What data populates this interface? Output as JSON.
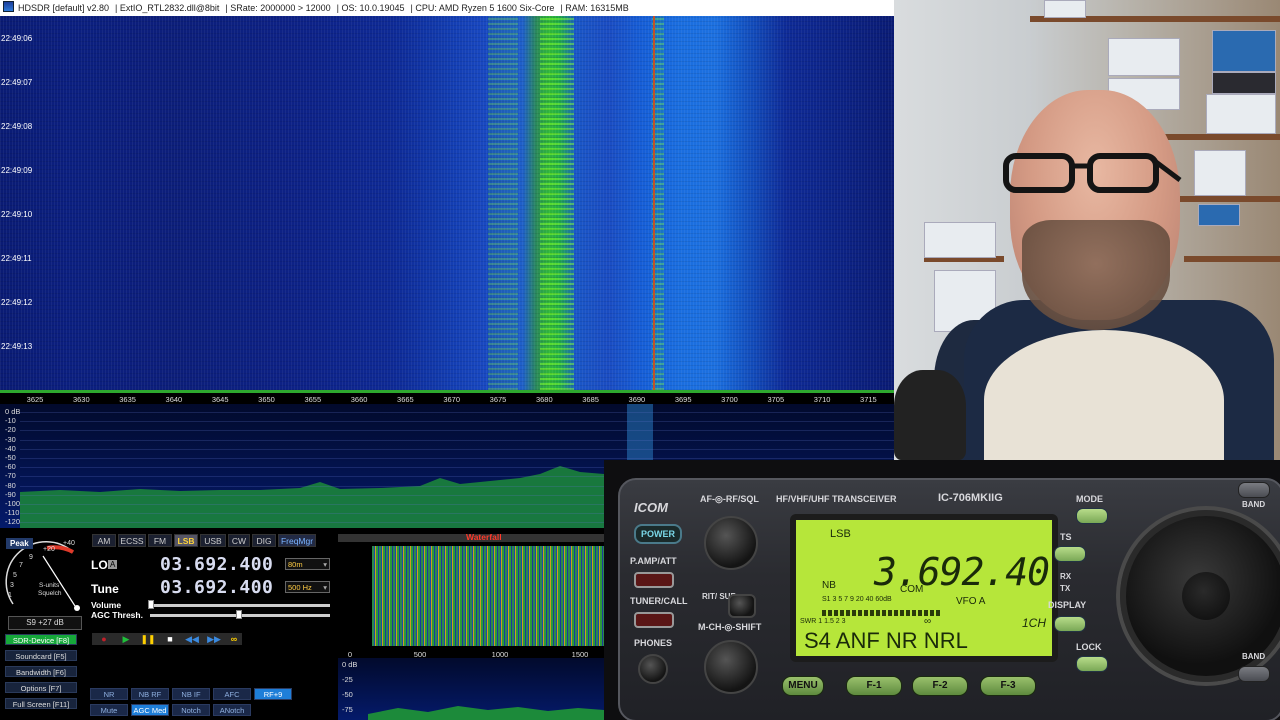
{
  "window": {
    "app": "HDSDR [default] v2.80",
    "extio": "ExtIO_RTL2832.dll@8bit",
    "srate": "SRate: 2000000 > 12000",
    "os": "OS: 10.0.19045",
    "cpu": "CPU: AMD Ryzen 5 1600 Six-Core",
    "ram": "RAM: 16315MB"
  },
  "waterfall": {
    "timestamps": [
      "22:49:06",
      "22:49:07",
      "22:49:08",
      "22:49:09",
      "22:49:10",
      "22:49:11",
      "22:49:12",
      "22:49:13"
    ]
  },
  "freq_scale": [
    "3625",
    "3630",
    "3635",
    "3640",
    "3645",
    "3650",
    "3655",
    "3660",
    "3665",
    "3670",
    "3675",
    "3680",
    "3685",
    "3690",
    "3695",
    "3700",
    "3705",
    "3710",
    "3715"
  ],
  "spectrum": {
    "db_labels": [
      "0 dB",
      "-10",
      "-20",
      "-30",
      "-40",
      "-50",
      "-60",
      "-70",
      "-80",
      "-90",
      "-100",
      "-110",
      "-120"
    ]
  },
  "smeter": {
    "peak_label": "Peak",
    "scale_top": "+40",
    "scale_mid": "+20",
    "numbers": [
      "9",
      "7",
      "5",
      "3",
      "1"
    ],
    "caption_1": "S-units",
    "caption_2": "Squelch",
    "reading": "S9 +27 dB"
  },
  "side_buttons": [
    {
      "label": "SDR-Device [F8]",
      "active": true
    },
    {
      "label": "Soundcard [F5]",
      "active": false
    },
    {
      "label": "Bandwidth [F6]",
      "active": false
    },
    {
      "label": "Options  [F7]",
      "active": false
    },
    {
      "label": "Full Screen [F11]",
      "active": false
    }
  ],
  "modes": [
    {
      "label": "AM",
      "on": false
    },
    {
      "label": "ECSS",
      "on": false
    },
    {
      "label": "FM",
      "on": false
    },
    {
      "label": "LSB",
      "on": true
    },
    {
      "label": "USB",
      "on": false
    },
    {
      "label": "CW",
      "on": false
    },
    {
      "label": "DIG",
      "on": false
    },
    {
      "label": "FreqMgr",
      "on": false
    }
  ],
  "lo": {
    "label": "LO",
    "badge": "A",
    "value": "03.692.400",
    "band": "80m"
  },
  "tune": {
    "label": "Tune",
    "value": "03.692.400",
    "bw": "500 Hz"
  },
  "volume_label": "Volume",
  "agc_label": "AGC Thresh.",
  "transport": {
    "loop": "∞"
  },
  "dsp_buttons_row1": [
    {
      "label": "NR",
      "on": false
    },
    {
      "label": "NB RF",
      "on": false
    },
    {
      "label": "NB IF",
      "on": false
    },
    {
      "label": "AFC",
      "on": false
    },
    {
      "label": "RF+9",
      "on": true
    }
  ],
  "dsp_buttons_row2": [
    {
      "label": "Mute",
      "on": false
    },
    {
      "label": "AGC Med",
      "on": true
    },
    {
      "label": "Notch",
      "on": false
    },
    {
      "label": "ANotch",
      "on": false
    }
  ],
  "audio": {
    "wf_label": "Waterfall",
    "ticks": [
      "0",
      "500",
      "1000",
      "1500"
    ],
    "db": [
      "0 dB",
      "-25",
      "-50",
      "-75"
    ]
  },
  "radio": {
    "brand": "ICOM",
    "model_line": "HF/VHF/UHF TRANSCEIVER",
    "model": "IC-706MKIIG",
    "af_rf": "AF-◎-RF/SQL",
    "power": "POWER",
    "pamp": "P.AMP/ATT",
    "tuner": "TUNER/CALL",
    "phones": "PHONES",
    "rit": "RIT/\nSUB",
    "mch": "M-CH-◎-SHIFT",
    "mode": "MODE",
    "ts": "TS",
    "rx": "RX",
    "tx": "TX",
    "display": "DISPLAY",
    "lock": "LOCK",
    "band": "BAND",
    "band2": "BAND",
    "menu": "MENU",
    "f1": "F-1",
    "f2": "F-2",
    "f3": "F-3",
    "lcd": {
      "mode": "LSB",
      "freq": "3.692.40",
      "nb": "NB",
      "com": "COM",
      "meter_scale": "S1  3  5  7  9  20  40 60dB",
      "vfo": "VFO A",
      "swr": "SWR  1  1.5  2  3",
      "inf": "∞",
      "ch": "1CH",
      "bottom": "S4 ANF   NR NRL"
    }
  }
}
